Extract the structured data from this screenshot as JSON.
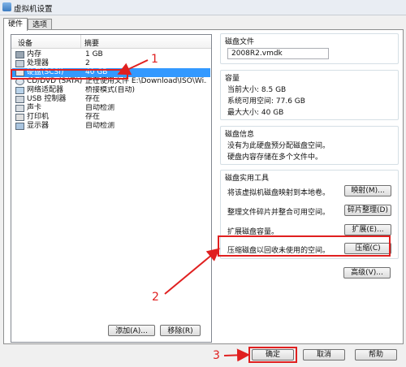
{
  "window": {
    "title": "虚拟机设置"
  },
  "tabs": [
    {
      "label": "硬件"
    },
    {
      "label": "选项"
    }
  ],
  "device_list": {
    "col_device": "设备",
    "col_summary": "摘要",
    "rows": [
      {
        "name": "内存",
        "summary": "1 GB",
        "icon": "memory-icon"
      },
      {
        "name": "处理器",
        "summary": "2",
        "icon": "cpu-icon"
      },
      {
        "name": "硬盘(SCSI)",
        "summary": "40 GB",
        "icon": "harddisk-icon",
        "selected": true
      },
      {
        "name": "CD/DVD (SATA)",
        "summary": "正在使用文件 E:\\Download\\ISO\\Wi...",
        "icon": "cd-dvd-icon"
      },
      {
        "name": "网络适配器",
        "summary": "桥接模式(自动)",
        "icon": "network-adapter-icon"
      },
      {
        "name": "USB 控制器",
        "summary": "存在",
        "icon": "usb-icon"
      },
      {
        "name": "声卡",
        "summary": "自动检测",
        "icon": "sound-card-icon"
      },
      {
        "name": "打印机",
        "summary": "存在",
        "icon": "printer-icon"
      },
      {
        "name": "显示器",
        "summary": "自动检测",
        "icon": "display-icon"
      }
    ],
    "add_button": "添加(A)...",
    "remove_button": "移除(R)"
  },
  "disk_file": {
    "title": "磁盘文件",
    "value": "2008R2.vmdk"
  },
  "capacity": {
    "title": "容量",
    "current": "当前大小: 8.5 GB",
    "available": "系统可用空间: 77.6 GB",
    "max": "最大大小: 40 GB"
  },
  "disk_info": {
    "title": "磁盘信息",
    "line1": "没有为此硬盘预分配磁盘空间。",
    "line2": "硬盘内容存储在多个文件中。"
  },
  "utilities": {
    "title": "磁盘实用工具",
    "map_label": "将该虚拟机磁盘映射到本地卷。",
    "map_button": "映射(M)...",
    "defrag_label": "整理文件碎片并整合可用空间。",
    "defrag_button": "碎片整理(D)",
    "expand_label": "扩展磁盘容量。",
    "expand_button": "扩展(E)...",
    "compact_label": "压缩磁盘以回收未使用的空间。",
    "compact_button": "压缩(C)"
  },
  "advanced_button": "高级(V)...",
  "footer": {
    "ok": "确定",
    "cancel": "取消",
    "help": "帮助"
  },
  "annotations": {
    "n1": "1",
    "n2": "2",
    "n3": "3"
  },
  "colors": {
    "highlight": "#e02020",
    "selection": "#3399ff"
  }
}
